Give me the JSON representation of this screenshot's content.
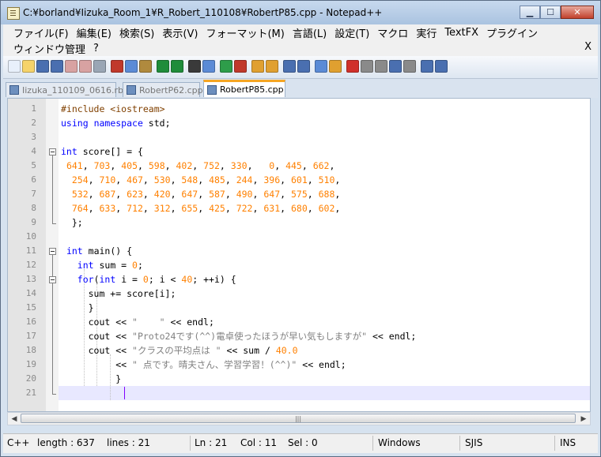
{
  "window": {
    "title": "C:¥borland¥Iizuka_Room_1¥R_Robert_110108¥RobertP85.cpp - Notepad++",
    "minimize_icon": "minimize-icon",
    "maximize_icon": "maximize-icon",
    "close_icon": "close-icon"
  },
  "menu": {
    "row1": [
      "ファイル(F)",
      "編集(E)",
      "検索(S)",
      "表示(V)",
      "フォーマット(M)",
      "言語(L)",
      "設定(T)",
      "マクロ",
      "実行",
      "TextFX",
      "プラグイン"
    ],
    "row2": [
      "ウィンドウ管理",
      "?"
    ],
    "close_label": "X"
  },
  "tabs": [
    {
      "label": "Iizuka_110109_0616.rb",
      "active": false
    },
    {
      "label": "RobertP62.cpp",
      "active": false
    },
    {
      "label": "RobertP85.cpp",
      "active": true
    }
  ],
  "editor": {
    "line_numbers": [
      "1",
      "2",
      "3",
      "4",
      "5",
      "6",
      "7",
      "8",
      "9",
      "10",
      "11",
      "12",
      "13",
      "14",
      "15",
      "16",
      "17",
      "18",
      "19",
      "20",
      "21"
    ],
    "lines": [
      [
        {
          "t": "#include <iostream>",
          "c": "pp"
        }
      ],
      [
        {
          "t": "using",
          "c": "kw"
        },
        {
          "t": " "
        },
        {
          "t": "namespace",
          "c": "kw"
        },
        {
          "t": " std;"
        }
      ],
      [],
      [
        {
          "t": "int",
          "c": "kw"
        },
        {
          "t": " score[] = {"
        }
      ],
      [
        {
          "t": " "
        },
        {
          "t": "641",
          "c": "num"
        },
        {
          "t": ", "
        },
        {
          "t": "703",
          "c": "num"
        },
        {
          "t": ", "
        },
        {
          "t": "405",
          "c": "num"
        },
        {
          "t": ", "
        },
        {
          "t": "598",
          "c": "num"
        },
        {
          "t": ", "
        },
        {
          "t": "402",
          "c": "num"
        },
        {
          "t": ", "
        },
        {
          "t": "752",
          "c": "num"
        },
        {
          "t": ", "
        },
        {
          "t": "330",
          "c": "num"
        },
        {
          "t": ",   "
        },
        {
          "t": "0",
          "c": "num"
        },
        {
          "t": ", "
        },
        {
          "t": "445",
          "c": "num"
        },
        {
          "t": ", "
        },
        {
          "t": "662",
          "c": "num"
        },
        {
          "t": ","
        }
      ],
      [
        {
          "t": "  "
        },
        {
          "t": "254",
          "c": "num"
        },
        {
          "t": ", "
        },
        {
          "t": "710",
          "c": "num"
        },
        {
          "t": ", "
        },
        {
          "t": "467",
          "c": "num"
        },
        {
          "t": ", "
        },
        {
          "t": "530",
          "c": "num"
        },
        {
          "t": ", "
        },
        {
          "t": "548",
          "c": "num"
        },
        {
          "t": ", "
        },
        {
          "t": "485",
          "c": "num"
        },
        {
          "t": ", "
        },
        {
          "t": "244",
          "c": "num"
        },
        {
          "t": ", "
        },
        {
          "t": "396",
          "c": "num"
        },
        {
          "t": ", "
        },
        {
          "t": "601",
          "c": "num"
        },
        {
          "t": ", "
        },
        {
          "t": "510",
          "c": "num"
        },
        {
          "t": ","
        }
      ],
      [
        {
          "t": "  "
        },
        {
          "t": "532",
          "c": "num"
        },
        {
          "t": ", "
        },
        {
          "t": "687",
          "c": "num"
        },
        {
          "t": ", "
        },
        {
          "t": "623",
          "c": "num"
        },
        {
          "t": ", "
        },
        {
          "t": "420",
          "c": "num"
        },
        {
          "t": ", "
        },
        {
          "t": "647",
          "c": "num"
        },
        {
          "t": ", "
        },
        {
          "t": "587",
          "c": "num"
        },
        {
          "t": ", "
        },
        {
          "t": "490",
          "c": "num"
        },
        {
          "t": ", "
        },
        {
          "t": "647",
          "c": "num"
        },
        {
          "t": ", "
        },
        {
          "t": "575",
          "c": "num"
        },
        {
          "t": ", "
        },
        {
          "t": "688",
          "c": "num"
        },
        {
          "t": ","
        }
      ],
      [
        {
          "t": "  "
        },
        {
          "t": "764",
          "c": "num"
        },
        {
          "t": ", "
        },
        {
          "t": "633",
          "c": "num"
        },
        {
          "t": ", "
        },
        {
          "t": "712",
          "c": "num"
        },
        {
          "t": ", "
        },
        {
          "t": "312",
          "c": "num"
        },
        {
          "t": ", "
        },
        {
          "t": "655",
          "c": "num"
        },
        {
          "t": ", "
        },
        {
          "t": "425",
          "c": "num"
        },
        {
          "t": ", "
        },
        {
          "t": "722",
          "c": "num"
        },
        {
          "t": ", "
        },
        {
          "t": "631",
          "c": "num"
        },
        {
          "t": ", "
        },
        {
          "t": "680",
          "c": "num"
        },
        {
          "t": ", "
        },
        {
          "t": "602",
          "c": "num"
        },
        {
          "t": ","
        }
      ],
      [
        {
          "t": "  };"
        }
      ],
      [],
      [
        {
          "t": " "
        },
        {
          "t": "int",
          "c": "kw"
        },
        {
          "t": " main() {"
        }
      ],
      [
        {
          "t": "   "
        },
        {
          "t": "int",
          "c": "kw"
        },
        {
          "t": " sum = "
        },
        {
          "t": "0",
          "c": "num"
        },
        {
          "t": ";"
        }
      ],
      [
        {
          "t": "   "
        },
        {
          "t": "for",
          "c": "kw"
        },
        {
          "t": "("
        },
        {
          "t": "int",
          "c": "kw"
        },
        {
          "t": " i = "
        },
        {
          "t": "0",
          "c": "num"
        },
        {
          "t": "; i < "
        },
        {
          "t": "40",
          "c": "num"
        },
        {
          "t": "; ++i) {"
        }
      ],
      [
        {
          "t": "     sum += score[i];"
        }
      ],
      [
        {
          "t": "     }"
        }
      ],
      [
        {
          "t": "     cout << "
        },
        {
          "t": "\"    \"",
          "c": "str"
        },
        {
          "t": " << endl;"
        }
      ],
      [
        {
          "t": "     cout << "
        },
        {
          "t": "\"Proto24です(^^)電卓使ったほうが早い気もしますが\"",
          "c": "str"
        },
        {
          "t": " << endl;"
        }
      ],
      [
        {
          "t": "     cout << "
        },
        {
          "t": "\"クラスの平均点は \"",
          "c": "str"
        },
        {
          "t": " << sum / "
        },
        {
          "t": "40.0",
          "c": "num"
        }
      ],
      [
        {
          "t": "          << "
        },
        {
          "t": "\" 点です。晴夫さん、学習学習！(^^)\"",
          "c": "str"
        },
        {
          "t": " << endl;"
        }
      ],
      [
        {
          "t": "          }"
        }
      ],
      []
    ]
  },
  "status": {
    "language": "C++",
    "length": "length : 637",
    "lines": "lines : 21",
    "ln": "Ln : 21",
    "col": "Col : 11",
    "sel": "Sel : 0",
    "eol": "Windows",
    "encoding": "SJIS",
    "mode": "INS"
  },
  "scroll": {
    "left_icon": "scroll-left-icon",
    "right_icon": "scroll-right-icon",
    "grip": "|||"
  },
  "toolbar": {
    "icons": [
      "new-file-icon",
      "open-file-icon",
      "save-icon",
      "save-all-icon",
      "close-icon",
      "close-all-icon",
      "print-icon",
      "cut-icon",
      "copy-icon",
      "paste-icon",
      "undo-icon",
      "redo-icon",
      "find-icon",
      "replace-icon",
      "zoom-in-icon",
      "zoom-out-icon",
      "sync-vertical-icon",
      "sync-horizontal-icon",
      "word-wrap-icon",
      "show-all-chars-icon",
      "indent-guide-icon",
      "user-lang-icon",
      "record-macro-icon",
      "stop-record-icon",
      "play-macro-icon",
      "run-macro-multiple-icon",
      "save-macro-icon",
      "tb-up-icon",
      "tb-up2-icon"
    ],
    "colors": [
      "#e8f0fb",
      "#f6d36a",
      "#4a6fb0",
      "#4a6fb0",
      "#d8a2a2",
      "#d8a2a2",
      "#9aa6b5",
      "#c0392b",
      "#5b8bd6",
      "#b08a3e",
      "#1f8c3a",
      "#1f8c3a",
      "#3a3a3a",
      "#5b8bd6",
      "#2e9d4a",
      "#c0392b",
      "#e0a030",
      "#e0a030",
      "#4a6fb0",
      "#4a6fb0",
      "#5b8bd6",
      "#e0a030",
      "#d0302a",
      "#8a8a8a",
      "#8a8a8a",
      "#4a6fb0",
      "#8a8a8a",
      "#4a6fb0",
      "#4a6fb0"
    ]
  }
}
